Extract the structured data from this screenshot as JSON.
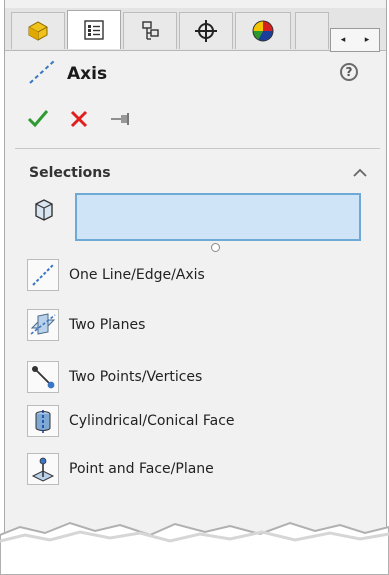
{
  "tabs": [
    {
      "id": "featuremanager",
      "icon": "feature-manager-icon"
    },
    {
      "id": "propertymanager",
      "icon": "property-manager-icon",
      "active": true
    },
    {
      "id": "configurationmanager",
      "icon": "configuration-manager-icon"
    },
    {
      "id": "dimxpert",
      "icon": "dimxpert-icon"
    },
    {
      "id": "display",
      "icon": "display-manager-icon"
    }
  ],
  "header": {
    "title": "Axis",
    "help_label": "?"
  },
  "selections": {
    "title": "Selections",
    "input_value": ""
  },
  "options": [
    {
      "label": "One Line/Edge/Axis",
      "icon": "line-edge-axis-icon"
    },
    {
      "label": "Two Planes",
      "icon": "two-planes-icon"
    },
    {
      "label": "Two Points/Vertices",
      "icon": "two-points-icon"
    },
    {
      "label": "Cylindrical/Conical Face",
      "icon": "cylindrical-face-icon"
    },
    {
      "label": "Point and Face/Plane",
      "icon": "point-face-icon"
    }
  ],
  "colors": {
    "accept": "#2e9b32",
    "cancel": "#e0201c",
    "selection_fill": "#cfe5f7",
    "selection_border": "#6fa9d6"
  }
}
